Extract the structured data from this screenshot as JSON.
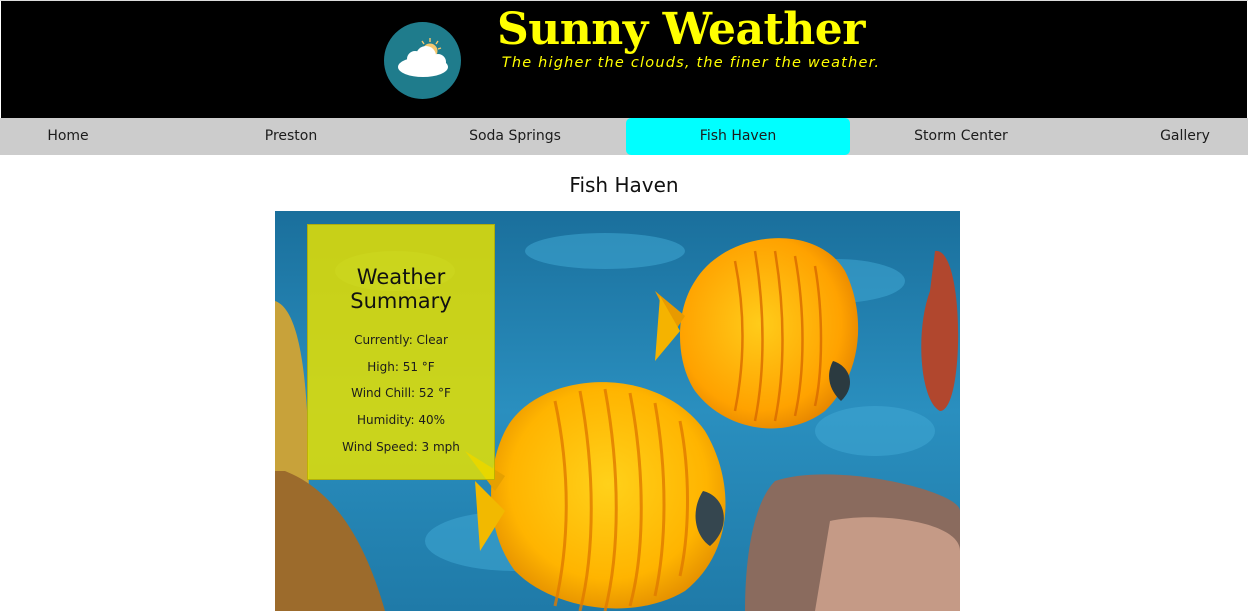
{
  "site": {
    "title": "Sunny Weather",
    "tagline": "The higher the clouds, the finer the weather.",
    "title_color": "#ffff00",
    "logo_icon": "cloud-sun-icon"
  },
  "nav": {
    "items": [
      {
        "label": "Home",
        "active": false
      },
      {
        "label": "Preston",
        "active": false
      },
      {
        "label": "Soda Springs",
        "active": false
      },
      {
        "label": "Fish Haven",
        "active": true
      },
      {
        "label": "Storm Center",
        "active": false
      },
      {
        "label": "Gallery",
        "active": false
      }
    ],
    "active_color": "#00ffff",
    "bar_color": "#cccccc"
  },
  "page": {
    "heading": "Fish Haven"
  },
  "hero": {
    "image_subject": "two yellow butterflyfish over a blue coral reef"
  },
  "summary": {
    "title_line1": "Weather",
    "title_line2": "Summary",
    "card_color": "#e6e000",
    "items": [
      "Currently: Clear",
      "High: 51 °F",
      "Wind Chill: 52 °F",
      "Humidity: 40%",
      "Wind Speed: 3 mph"
    ]
  }
}
